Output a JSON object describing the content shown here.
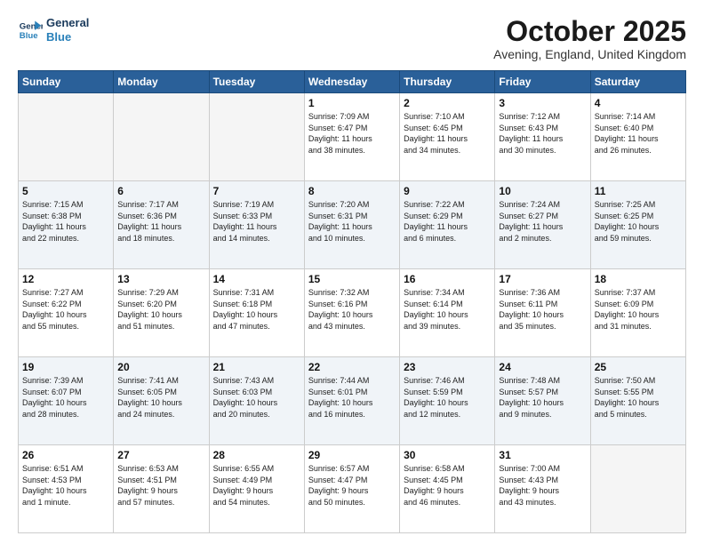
{
  "header": {
    "logo_line1": "General",
    "logo_line2": "Blue",
    "month": "October 2025",
    "location": "Avening, England, United Kingdom"
  },
  "weekdays": [
    "Sunday",
    "Monday",
    "Tuesday",
    "Wednesday",
    "Thursday",
    "Friday",
    "Saturday"
  ],
  "weeks": [
    [
      {
        "day": "",
        "info": ""
      },
      {
        "day": "",
        "info": ""
      },
      {
        "day": "",
        "info": ""
      },
      {
        "day": "1",
        "info": "Sunrise: 7:09 AM\nSunset: 6:47 PM\nDaylight: 11 hours\nand 38 minutes."
      },
      {
        "day": "2",
        "info": "Sunrise: 7:10 AM\nSunset: 6:45 PM\nDaylight: 11 hours\nand 34 minutes."
      },
      {
        "day": "3",
        "info": "Sunrise: 7:12 AM\nSunset: 6:43 PM\nDaylight: 11 hours\nand 30 minutes."
      },
      {
        "day": "4",
        "info": "Sunrise: 7:14 AM\nSunset: 6:40 PM\nDaylight: 11 hours\nand 26 minutes."
      }
    ],
    [
      {
        "day": "5",
        "info": "Sunrise: 7:15 AM\nSunset: 6:38 PM\nDaylight: 11 hours\nand 22 minutes."
      },
      {
        "day": "6",
        "info": "Sunrise: 7:17 AM\nSunset: 6:36 PM\nDaylight: 11 hours\nand 18 minutes."
      },
      {
        "day": "7",
        "info": "Sunrise: 7:19 AM\nSunset: 6:33 PM\nDaylight: 11 hours\nand 14 minutes."
      },
      {
        "day": "8",
        "info": "Sunrise: 7:20 AM\nSunset: 6:31 PM\nDaylight: 11 hours\nand 10 minutes."
      },
      {
        "day": "9",
        "info": "Sunrise: 7:22 AM\nSunset: 6:29 PM\nDaylight: 11 hours\nand 6 minutes."
      },
      {
        "day": "10",
        "info": "Sunrise: 7:24 AM\nSunset: 6:27 PM\nDaylight: 11 hours\nand 2 minutes."
      },
      {
        "day": "11",
        "info": "Sunrise: 7:25 AM\nSunset: 6:25 PM\nDaylight: 10 hours\nand 59 minutes."
      }
    ],
    [
      {
        "day": "12",
        "info": "Sunrise: 7:27 AM\nSunset: 6:22 PM\nDaylight: 10 hours\nand 55 minutes."
      },
      {
        "day": "13",
        "info": "Sunrise: 7:29 AM\nSunset: 6:20 PM\nDaylight: 10 hours\nand 51 minutes."
      },
      {
        "day": "14",
        "info": "Sunrise: 7:31 AM\nSunset: 6:18 PM\nDaylight: 10 hours\nand 47 minutes."
      },
      {
        "day": "15",
        "info": "Sunrise: 7:32 AM\nSunset: 6:16 PM\nDaylight: 10 hours\nand 43 minutes."
      },
      {
        "day": "16",
        "info": "Sunrise: 7:34 AM\nSunset: 6:14 PM\nDaylight: 10 hours\nand 39 minutes."
      },
      {
        "day": "17",
        "info": "Sunrise: 7:36 AM\nSunset: 6:11 PM\nDaylight: 10 hours\nand 35 minutes."
      },
      {
        "day": "18",
        "info": "Sunrise: 7:37 AM\nSunset: 6:09 PM\nDaylight: 10 hours\nand 31 minutes."
      }
    ],
    [
      {
        "day": "19",
        "info": "Sunrise: 7:39 AM\nSunset: 6:07 PM\nDaylight: 10 hours\nand 28 minutes."
      },
      {
        "day": "20",
        "info": "Sunrise: 7:41 AM\nSunset: 6:05 PM\nDaylight: 10 hours\nand 24 minutes."
      },
      {
        "day": "21",
        "info": "Sunrise: 7:43 AM\nSunset: 6:03 PM\nDaylight: 10 hours\nand 20 minutes."
      },
      {
        "day": "22",
        "info": "Sunrise: 7:44 AM\nSunset: 6:01 PM\nDaylight: 10 hours\nand 16 minutes."
      },
      {
        "day": "23",
        "info": "Sunrise: 7:46 AM\nSunset: 5:59 PM\nDaylight: 10 hours\nand 12 minutes."
      },
      {
        "day": "24",
        "info": "Sunrise: 7:48 AM\nSunset: 5:57 PM\nDaylight: 10 hours\nand 9 minutes."
      },
      {
        "day": "25",
        "info": "Sunrise: 7:50 AM\nSunset: 5:55 PM\nDaylight: 10 hours\nand 5 minutes."
      }
    ],
    [
      {
        "day": "26",
        "info": "Sunrise: 6:51 AM\nSunset: 4:53 PM\nDaylight: 10 hours\nand 1 minute."
      },
      {
        "day": "27",
        "info": "Sunrise: 6:53 AM\nSunset: 4:51 PM\nDaylight: 9 hours\nand 57 minutes."
      },
      {
        "day": "28",
        "info": "Sunrise: 6:55 AM\nSunset: 4:49 PM\nDaylight: 9 hours\nand 54 minutes."
      },
      {
        "day": "29",
        "info": "Sunrise: 6:57 AM\nSunset: 4:47 PM\nDaylight: 9 hours\nand 50 minutes."
      },
      {
        "day": "30",
        "info": "Sunrise: 6:58 AM\nSunset: 4:45 PM\nDaylight: 9 hours\nand 46 minutes."
      },
      {
        "day": "31",
        "info": "Sunrise: 7:00 AM\nSunset: 4:43 PM\nDaylight: 9 hours\nand 43 minutes."
      },
      {
        "day": "",
        "info": ""
      }
    ]
  ]
}
